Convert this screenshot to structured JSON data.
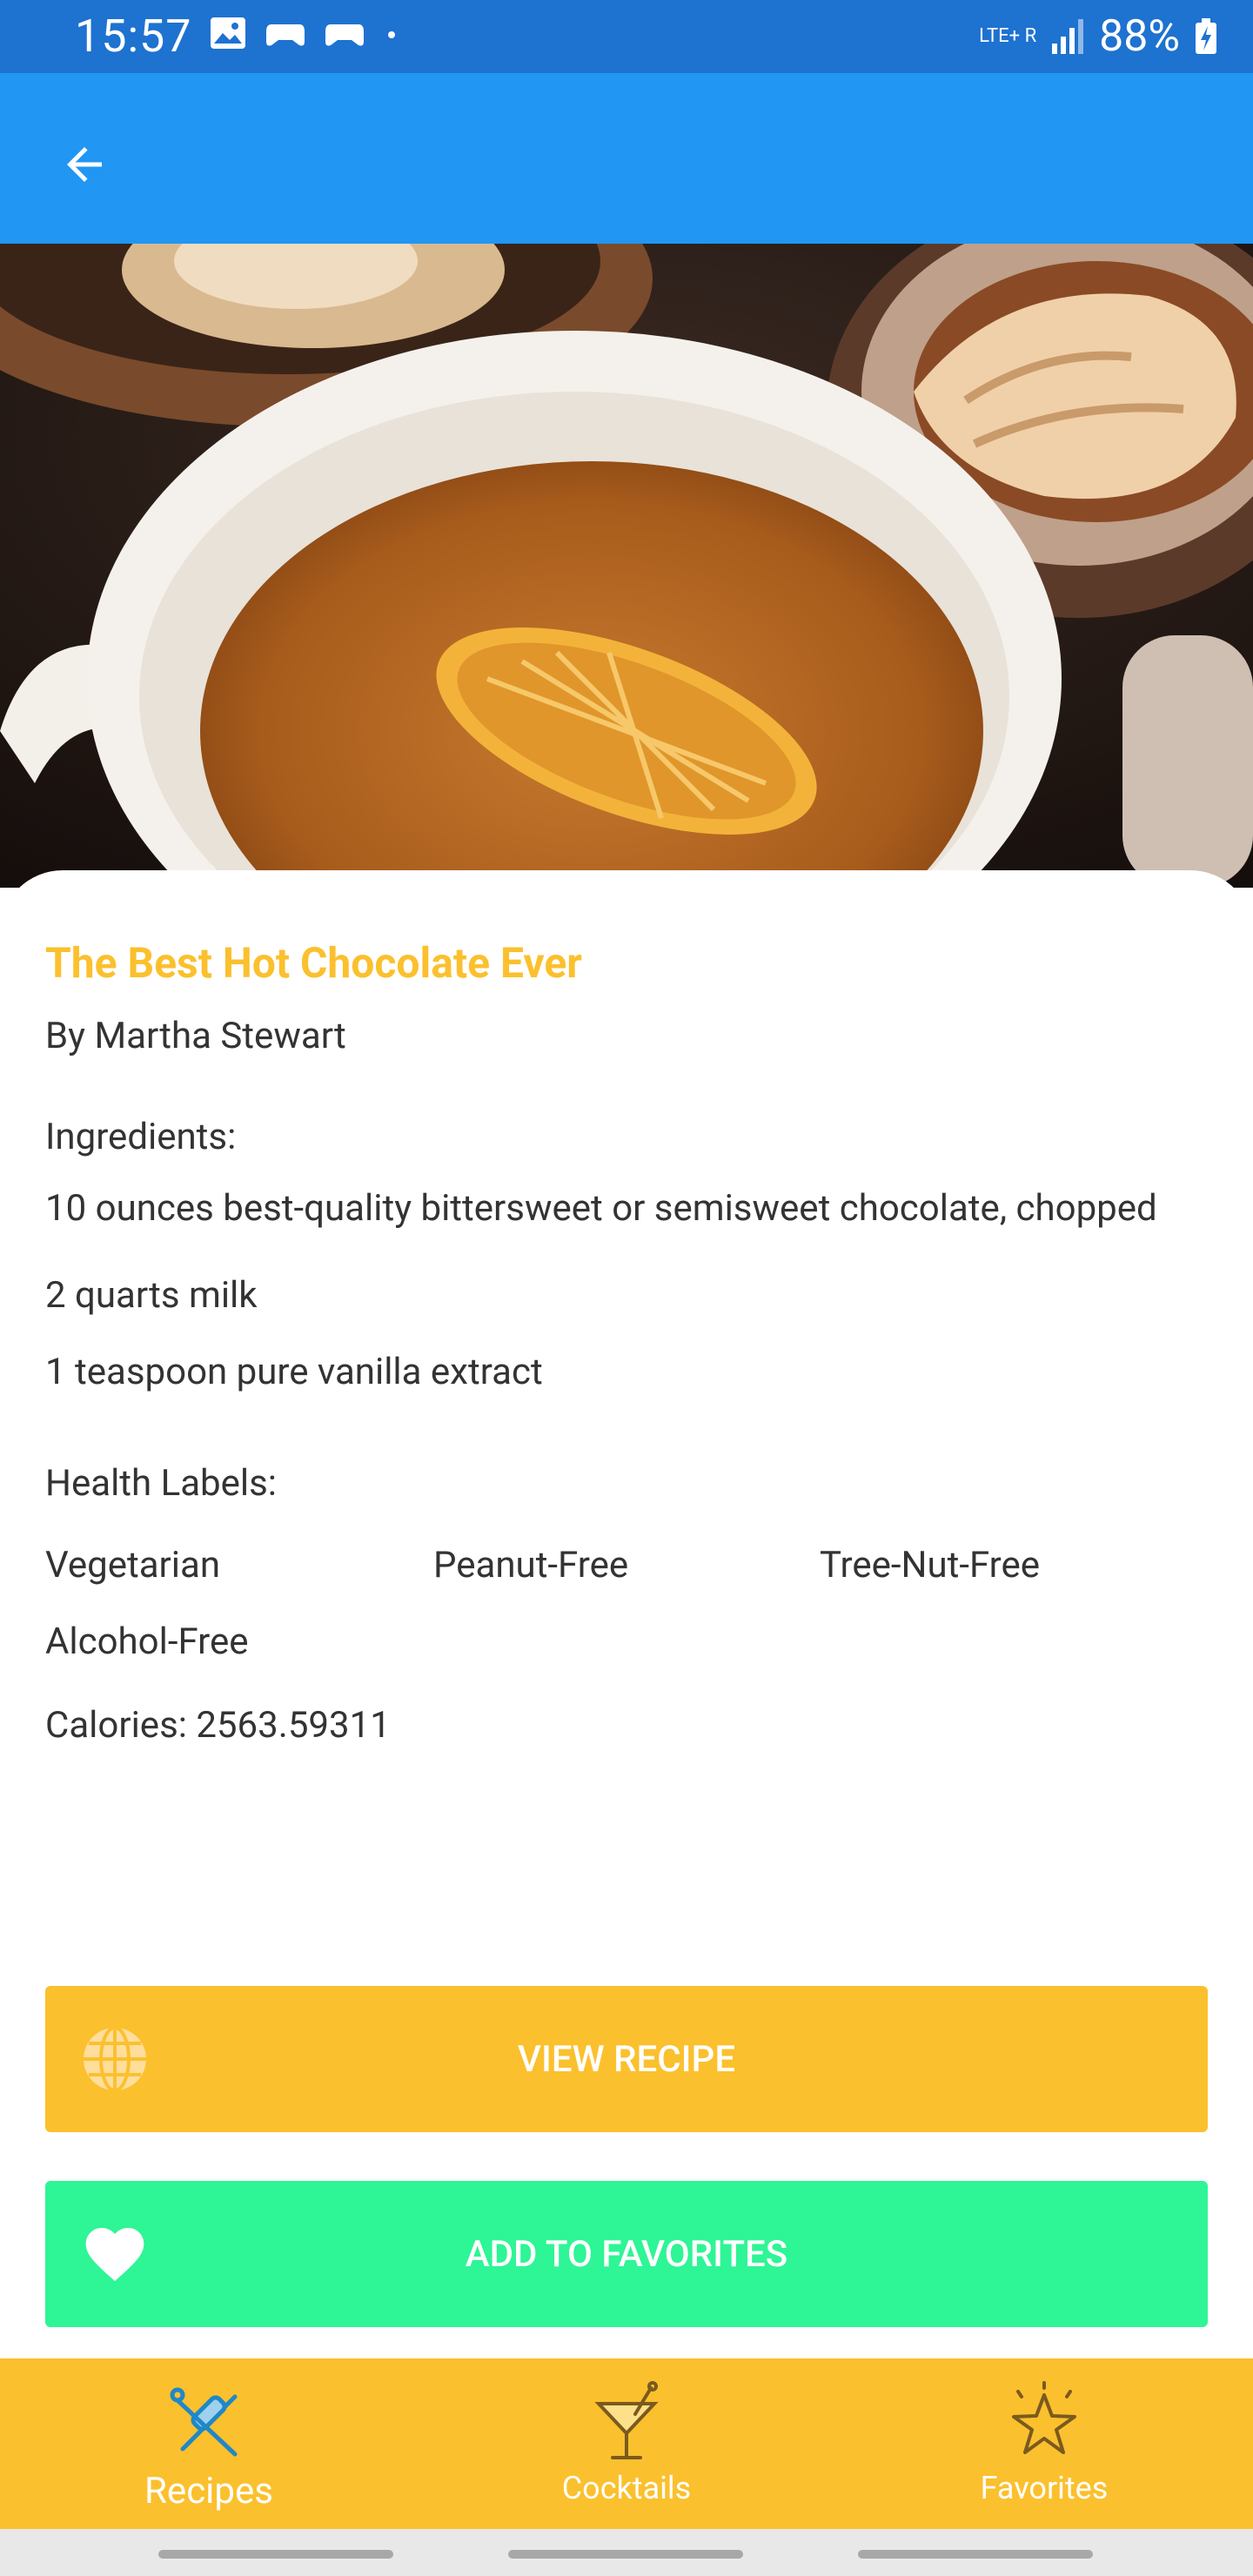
{
  "status": {
    "time": "15:57",
    "network": "LTE+ R",
    "battery": "88%"
  },
  "recipe": {
    "title": "The Best Hot Chocolate Ever",
    "author": "By Martha Stewart",
    "ingredients_label": "Ingredients:",
    "ingredients": [
      "10 ounces best-quality bittersweet or semisweet chocolate, chopped",
      "2 quarts milk",
      "1 teaspoon pure vanilla extract"
    ],
    "health_label": "Health Labels:",
    "health_labels": [
      "Vegetarian",
      "Peanut-Free",
      "Tree-Nut-Free",
      "Alcohol-Free"
    ],
    "calories": "Calories: 2563.59311"
  },
  "buttons": {
    "view_recipe": "VIEW RECIPE",
    "add_favorites": "ADD TO FAVORITES"
  },
  "bottom_nav": [
    {
      "label": "Recipes",
      "icon": "rolling-pin-icon",
      "active": true
    },
    {
      "label": "Cocktails",
      "icon": "cocktail-icon",
      "active": false
    },
    {
      "label": "Favorites",
      "icon": "star-icon",
      "active": false
    }
  ],
  "colors": {
    "app_bar": "#2196f3",
    "status_bar": "#1e72d0",
    "title": "#fbc02d",
    "view_button": "#fbc02d",
    "fav_button": "#2ef595",
    "bottom_nav": "#fbc02d"
  }
}
